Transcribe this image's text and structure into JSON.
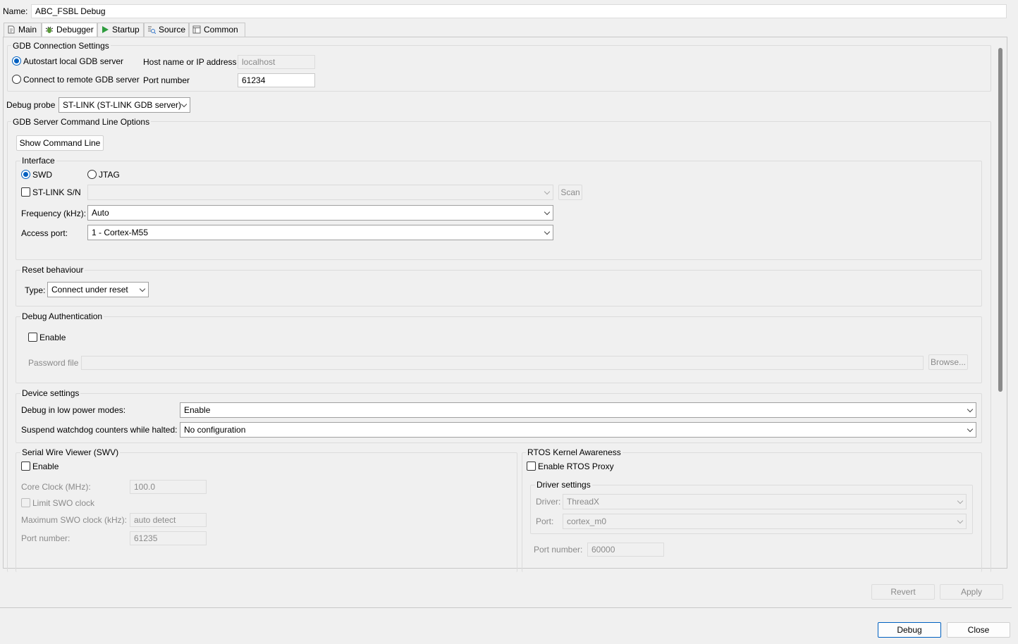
{
  "name": {
    "label": "Name:",
    "value": "ABC_FSBL Debug"
  },
  "tabs": [
    {
      "label": "Main",
      "icon": "document-icon"
    },
    {
      "label": "Debugger",
      "icon": "bug-icon"
    },
    {
      "label": "Startup",
      "icon": "play-icon"
    },
    {
      "label": "Source",
      "icon": "source-lookup-icon"
    },
    {
      "label": "Common",
      "icon": "window-icon"
    }
  ],
  "gdb": {
    "title": "GDB Connection Settings",
    "autostart": "Autostart local GDB server",
    "remote": "Connect to remote GDB server",
    "host_label": "Host name or IP address",
    "host_value": "localhost",
    "port_label": "Port number",
    "port_value": "61234"
  },
  "probe": {
    "label": "Debug probe",
    "value": "ST-LINK (ST-LINK GDB server)"
  },
  "server_options": {
    "title": "GDB Server Command Line Options",
    "show_cmd": "Show Command Line",
    "interface": {
      "title": "Interface",
      "swd": "SWD",
      "jtag": "JTAG",
      "stlink_sn": "ST-LINK S/N",
      "stlink_sn_value": "",
      "scan": "Scan",
      "freq_label": "Frequency (kHz):",
      "freq_value": "Auto",
      "access_label": "Access port:",
      "access_value": "1 - Cortex-M55"
    },
    "reset": {
      "title": "Reset behaviour",
      "type_label": "Type:",
      "type_value": "Connect under reset"
    },
    "auth": {
      "title": "Debug Authentication",
      "enable": "Enable",
      "password_label": "Password file",
      "password_value": "",
      "browse": "Browse..."
    },
    "device": {
      "title": "Device settings",
      "low_power_label": "Debug in low power modes:",
      "low_power_value": "Enable",
      "watchdog_label": "Suspend watchdog counters while halted:",
      "watchdog_value": "No configuration"
    },
    "swv": {
      "title": "Serial Wire Viewer (SWV)",
      "enable": "Enable",
      "core_clock_label": "Core Clock (MHz):",
      "core_clock_value": "100.0",
      "limit_swo": "Limit SWO clock",
      "max_swo_label": "Maximum SWO clock (kHz):",
      "max_swo_value": "auto detect",
      "port_label": "Port number:",
      "port_value": "61235"
    },
    "rtos": {
      "title": "RTOS Kernel Awareness",
      "enable_proxy": "Enable RTOS Proxy",
      "driver_settings": "Driver settings",
      "driver_label": "Driver:",
      "driver_value": "ThreadX",
      "port_label": "Port:",
      "port_value": "cortex_m0",
      "port_number_label": "Port number:",
      "port_number_value": "60000"
    }
  },
  "footer": {
    "revert": "Revert",
    "apply": "Apply",
    "debug": "Debug",
    "close": "Close"
  }
}
